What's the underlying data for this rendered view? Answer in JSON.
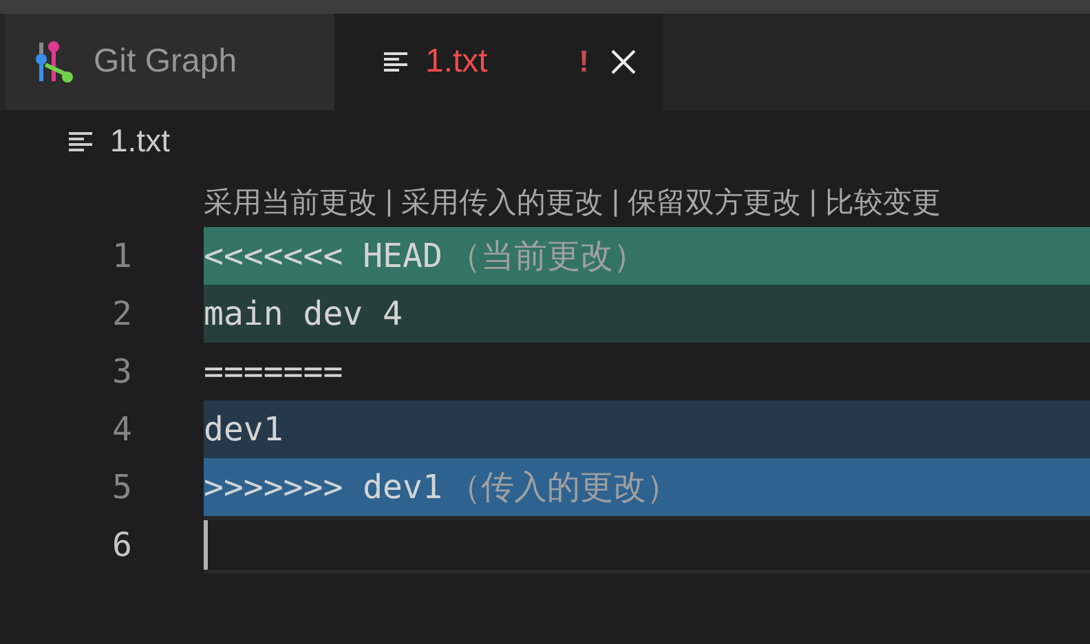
{
  "tabs": [
    {
      "label": "Git Graph",
      "kind": "graph",
      "selected": false,
      "error": false
    },
    {
      "label": "1.txt",
      "kind": "file",
      "selected": true,
      "error": true,
      "badge": "!"
    }
  ],
  "breadcrumb": {
    "label": "1.txt"
  },
  "codelens": {
    "separator": "|",
    "actions": [
      "采用当前更改",
      "采用传入的更改",
      "保留双方更改",
      "比较变更"
    ]
  },
  "lines": [
    {
      "number": "1",
      "text": "<<<<<<< HEAD",
      "hint": "（当前更改）",
      "kind": "current-marker",
      "active": false
    },
    {
      "number": "2",
      "text": "main dev 4",
      "kind": "current",
      "active": false
    },
    {
      "number": "3",
      "text": "=======",
      "kind": "plain",
      "active": false
    },
    {
      "number": "4",
      "text": "dev1",
      "kind": "incoming",
      "active": false
    },
    {
      "number": "5",
      "text": ">>>>>>> dev1",
      "hint": "（传入的更改）",
      "kind": "incoming-marker",
      "active": false
    },
    {
      "number": "6",
      "kind": "plain",
      "active": true
    }
  ]
}
